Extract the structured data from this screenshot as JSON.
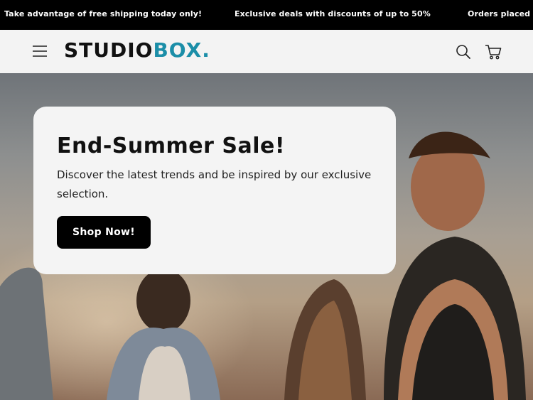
{
  "announcement": {
    "messages": [
      "Take advantage of free shipping today only!",
      "Exclusive deals with discounts of up to 50%",
      "Orders placed b"
    ]
  },
  "header": {
    "logo_main": "STUDIO",
    "logo_accent": "BOX.",
    "accent_color": "#1b8ea8",
    "icons": [
      "menu-icon",
      "search-icon",
      "cart-icon"
    ]
  },
  "hero": {
    "title": "End-Summer Sale!",
    "description": "Discover the latest trends and be inspired by our exclusive selection.",
    "cta_label": "Shop Now!"
  }
}
